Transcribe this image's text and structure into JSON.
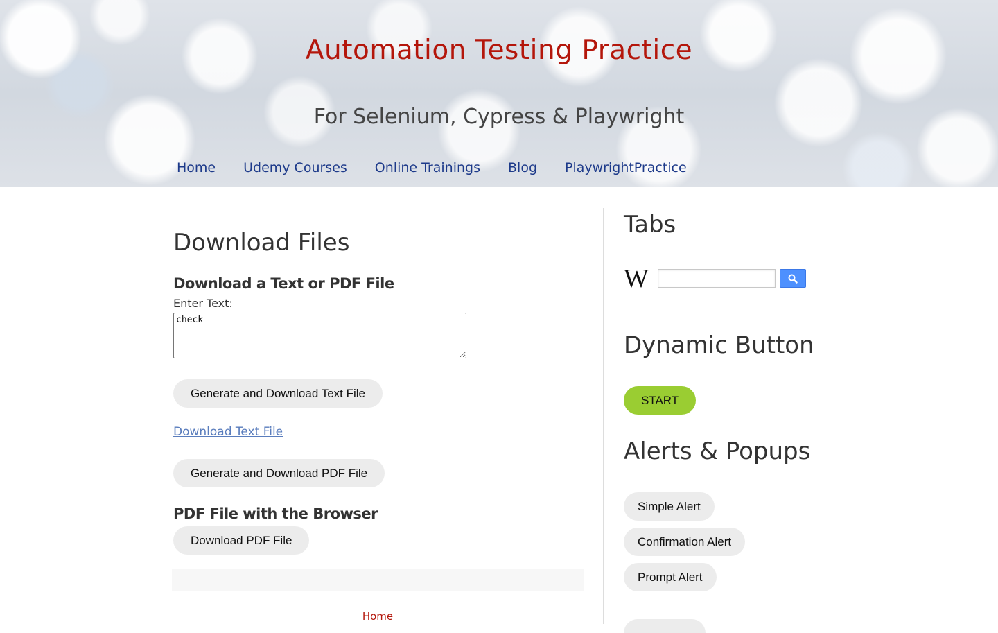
{
  "header": {
    "title": "Automation Testing Practice",
    "subtitle": "For Selenium, Cypress & Playwright",
    "nav": [
      "Home",
      "Udemy Courses",
      "Online Trainings",
      "Blog",
      "PlaywrightPractice"
    ],
    "title_color": "#b4160b",
    "nav_color": "#1d3a8a"
  },
  "main": {
    "heading": "Download Files",
    "section1_heading": "Download a Text or PDF File",
    "enter_text_label": "Enter Text:",
    "textarea_value": "check",
    "btn_generate_text": "Generate and Download Text File",
    "link_download_text": "Download Text File",
    "btn_generate_pdf": "Generate and Download PDF File",
    "section2_heading": "PDF File with the Browser",
    "btn_download_pdf": "Download PDF File",
    "footer_home": "Home"
  },
  "sidebar": {
    "tabs_heading": "Tabs",
    "wiki_search_value": "",
    "dynamic_heading": "Dynamic Button",
    "start_label": "START",
    "start_color": "#9acd32",
    "alerts_heading": "Alerts & Popups",
    "alert_buttons": [
      "Simple Alert",
      "Confirmation Alert",
      "Prompt Alert"
    ]
  }
}
